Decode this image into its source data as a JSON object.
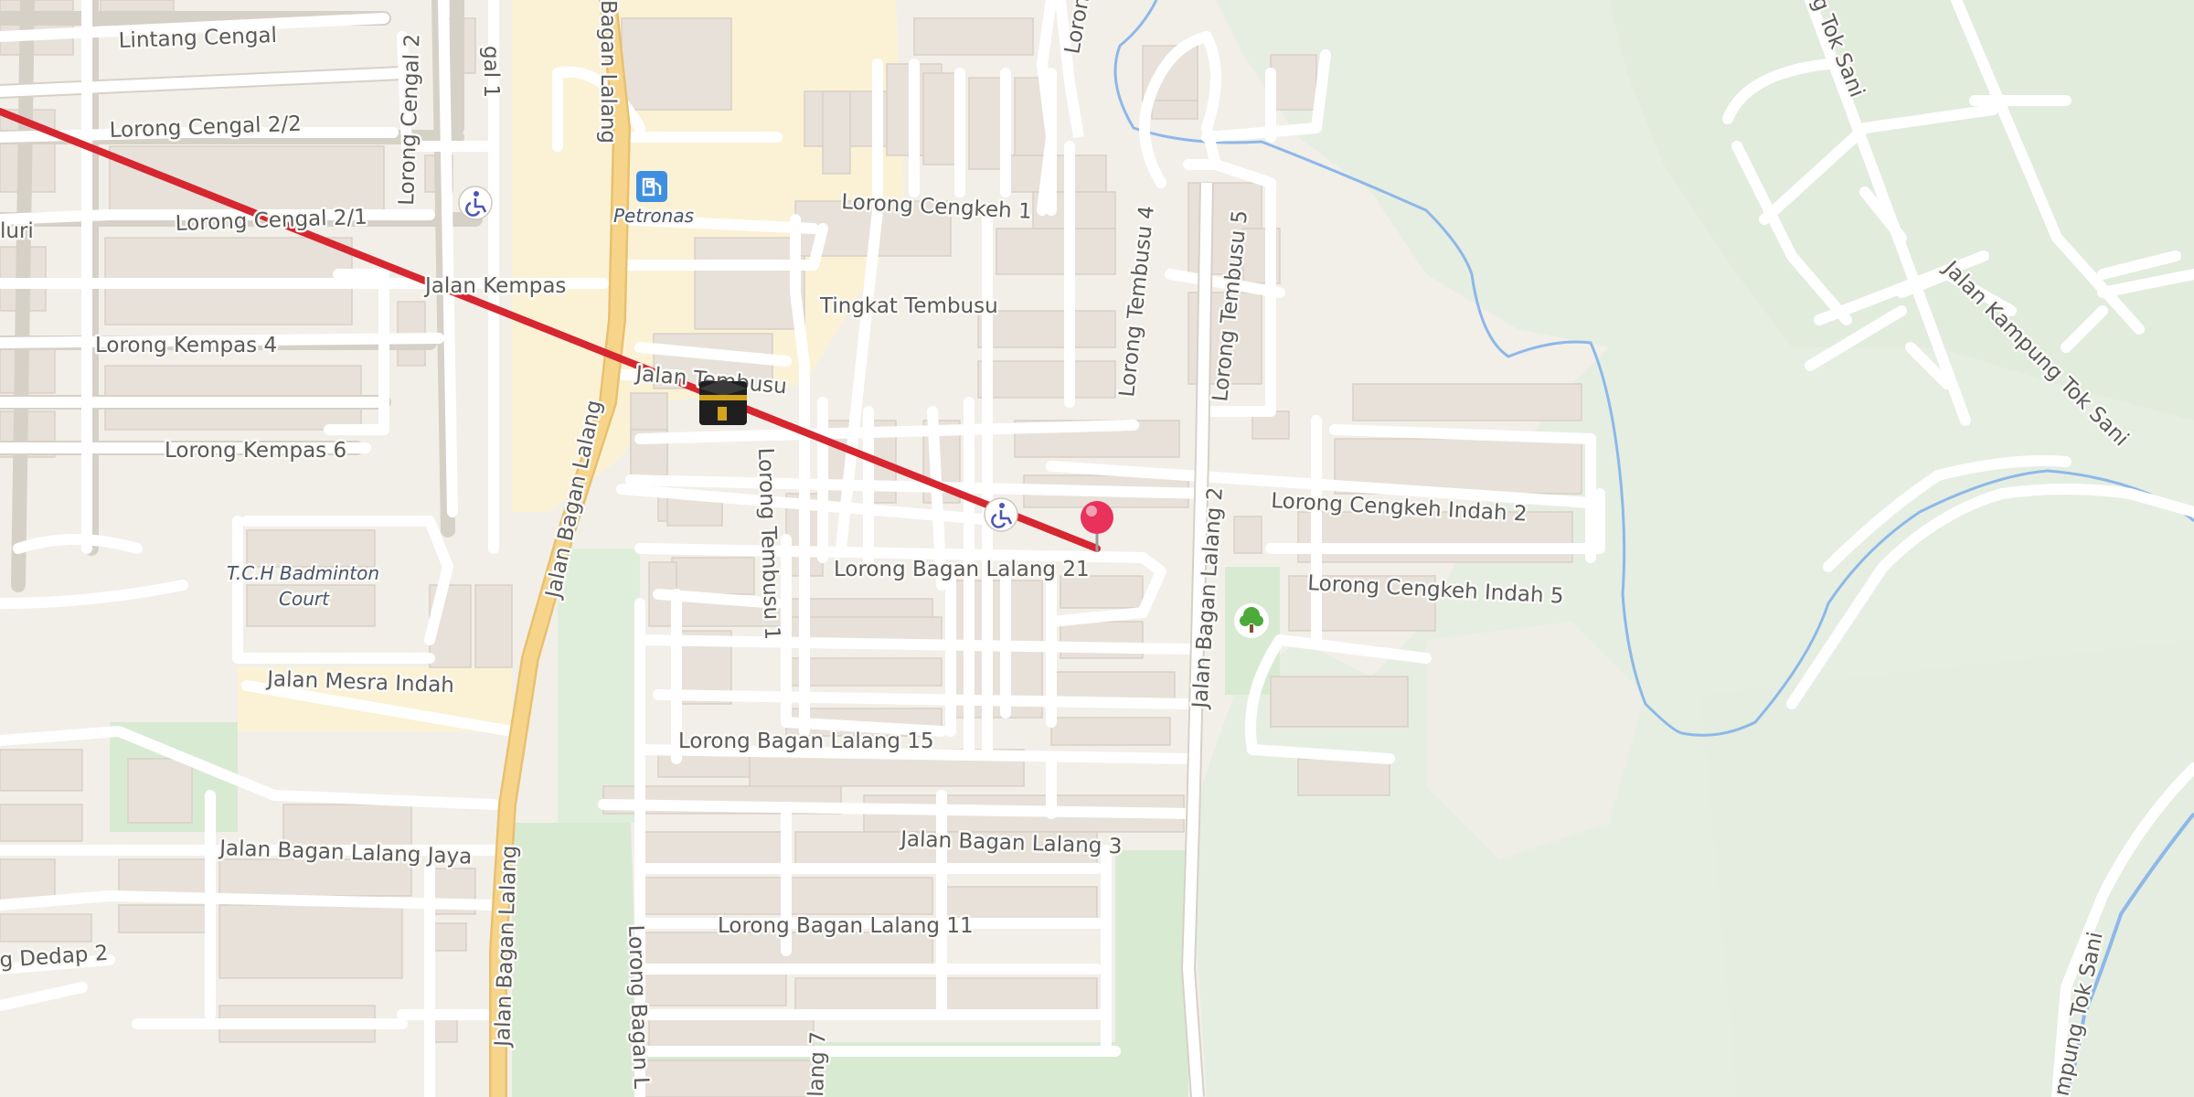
{
  "map": {
    "colors": {
      "land": "#f2efe9",
      "commercial": "#fbf2d6",
      "park": "#d9ead3",
      "wood": "#e3ede0",
      "building": "#e8e1d9",
      "road": "#ffffff",
      "main_road": "#f6d58b",
      "water": "#8db8e8",
      "route_line": "#d6262f",
      "pin": "#e8315b"
    },
    "street_labels": {
      "lintang_cengal": "Lintang Cengal",
      "lorong_cengal_2_2": "Lorong Cengal 2/2",
      "lorong_cengal_2_1": "Lorong Cengal 2/1",
      "luri_fragment": "luri",
      "jalan_kempas": "Jalan Kempas",
      "lorong_kempas_4": "Lorong Kempas 4",
      "lorong_kempas_6": "Lorong Kempas 6",
      "lorong_cengal_2": "Lorong Cengal 2",
      "gal_1_fragment": "gal 1",
      "bagan_lalang_top": "Bagan Lalang",
      "jalan_bagan_lalang_mid": "Jalan Bagan Lalang",
      "jalan_bagan_lalang_bottom": "Jalan Bagan Lalang",
      "lorong_cengkeh_1": "Lorong Cengkeh 1",
      "tingkat_tembusu": "Tingkat Tembusu",
      "jalan_tembusu": "Jalan Tembusu",
      "lorong_tembusu_1": "Lorong Tembusu 1",
      "lorong_tembusu_4": "Lorong Tembusu 4",
      "lorong_tembusu_5": "Lorong Tembusu 5",
      "lorong_top_fragment": "Lorong",
      "lorong_bagan_lalang_21": "Lorong Bagan Lalang 21",
      "lorong_bagan_lalang_15": "Lorong Bagan Lalang 15",
      "lorong_bagan_lalang_11": "Lorong Bagan Lalang 11",
      "jalan_bagan_lalang_3": "Jalan Bagan Lalang 3",
      "jalan_bagan_lalang_2": "Jalan Bagan Lalang 2",
      "lorong_bagan_l_fragment": "Lorong Bagan L",
      "lang_7_fragment": "lang 7",
      "jalan_mesra_indah": "Jalan Mesra Indah",
      "jalan_bagan_lalang_jaya": "Jalan Bagan Lalang Jaya",
      "dedap_fragment": "g Dedap 2",
      "lorong_cengkeh_indah_2": "Lorong Cengkeh Indah 2",
      "lorong_cengkeh_indah_5": "Lorong Cengkeh Indah 5",
      "jalan_kampung_tok_sani": "Jalan Kampung Tok Sani",
      "tok_sani_top": "g Tok Sani",
      "tok_sani_bottom": "mpung Tok Sani"
    },
    "pois": {
      "fuel_station_label": "Petronas",
      "badminton_line1": "T.C.H Badminton",
      "badminton_line2": "Court"
    },
    "icons": {
      "fuel": "fuel-pump-icon",
      "mosque": "kaaba-mosque-icon",
      "wheelchair_1": "wheelchair-icon",
      "wheelchair_2": "wheelchair-icon",
      "park": "tree-icon",
      "pin": "location-pin-icon"
    }
  }
}
